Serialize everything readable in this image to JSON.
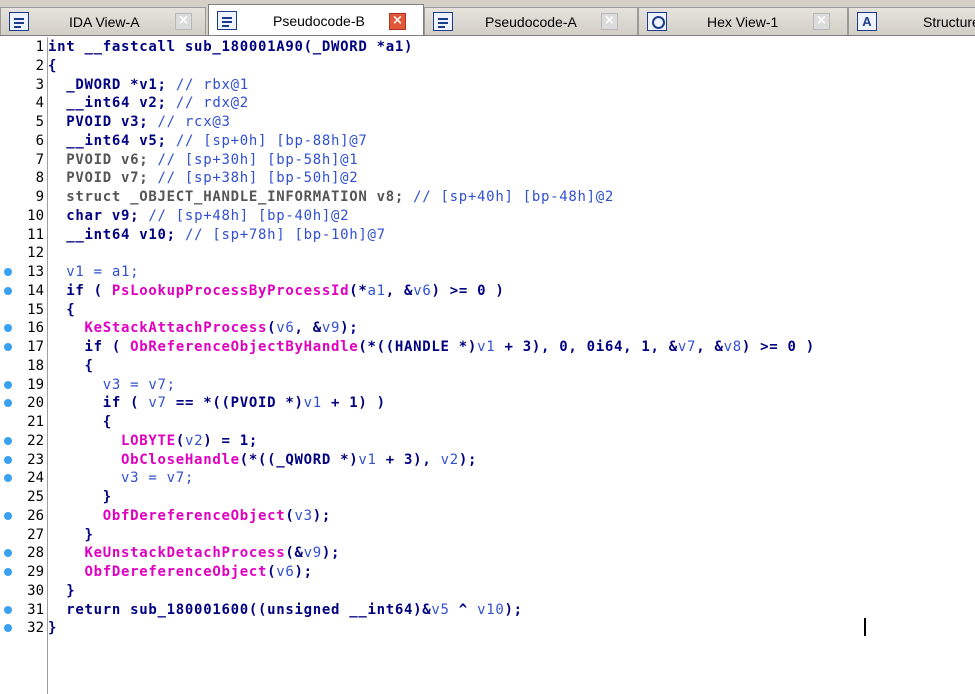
{
  "tabs": [
    {
      "label": "IDA View-A",
      "icon": "disassembly-icon",
      "close": "×",
      "active": false
    },
    {
      "label": "Pseudocode-B",
      "icon": "pseudocode-icon",
      "close": "×",
      "active": true
    },
    {
      "label": "Pseudocode-A",
      "icon": "pseudocode-icon",
      "close": "×",
      "active": false
    },
    {
      "label": "Hex View-1",
      "icon": "hex-view-icon",
      "close": "×",
      "active": false
    },
    {
      "label": "Structure",
      "icon": "structure-icon",
      "close": "",
      "active": false
    }
  ],
  "structure_icon_letter": "A",
  "code_lines": [
    {
      "n": "1",
      "bp": false,
      "tokens": [
        [
          "kw",
          "int __fastcall sub_180001A90(_DWORD *a1)"
        ]
      ]
    },
    {
      "n": "2",
      "bp": false,
      "tokens": [
        [
          "plain",
          "{"
        ]
      ]
    },
    {
      "n": "3",
      "bp": false,
      "tokens": [
        [
          "plain",
          "  _DWORD *v1; "
        ],
        [
          "cmt",
          "// rbx@1"
        ]
      ]
    },
    {
      "n": "4",
      "bp": false,
      "tokens": [
        [
          "plain",
          "  __int64 v2; "
        ],
        [
          "cmt",
          "// rdx@2"
        ]
      ]
    },
    {
      "n": "5",
      "bp": false,
      "tokens": [
        [
          "plain",
          "  PVOID v3; "
        ],
        [
          "cmt",
          "// rcx@3"
        ]
      ]
    },
    {
      "n": "6",
      "bp": false,
      "tokens": [
        [
          "plain",
          "  __int64 v5; "
        ],
        [
          "cmt",
          "// [sp+0h] [bp-88h]@7"
        ]
      ]
    },
    {
      "n": "7",
      "bp": false,
      "tokens": [
        [
          "dimb",
          "  PVOID v6; "
        ],
        [
          "cmt",
          "// [sp+30h] [bp-58h]@1"
        ]
      ]
    },
    {
      "n": "8",
      "bp": false,
      "tokens": [
        [
          "dimb",
          "  PVOID v7; "
        ],
        [
          "cmt",
          "// [sp+38h] [bp-50h]@2"
        ]
      ]
    },
    {
      "n": "9",
      "bp": false,
      "tokens": [
        [
          "dimb",
          "  struct _OBJECT_HANDLE_INFORMATION v8; "
        ],
        [
          "cmt",
          "// [sp+40h] [bp-48h]@2"
        ]
      ]
    },
    {
      "n": "10",
      "bp": false,
      "tokens": [
        [
          "plain",
          "  char v9; "
        ],
        [
          "cmt",
          "// [sp+48h] [bp-40h]@2"
        ]
      ]
    },
    {
      "n": "11",
      "bp": false,
      "tokens": [
        [
          "plain",
          "  __int64 v10; "
        ],
        [
          "cmt",
          "// [sp+78h] [bp-10h]@7"
        ]
      ]
    },
    {
      "n": "12",
      "bp": false,
      "tokens": []
    },
    {
      "n": "13",
      "bp": true,
      "tokens": [
        [
          "var",
          "  v1 = a1;"
        ]
      ]
    },
    {
      "n": "14",
      "bp": true,
      "tokens": [
        [
          "plain",
          "  if ( "
        ],
        [
          "fn",
          "PsLookupProcessByProcessId"
        ],
        [
          "plain",
          "(*"
        ],
        [
          "var",
          "a1"
        ],
        [
          "plain",
          ", &"
        ],
        [
          "var",
          "v6"
        ],
        [
          "plain",
          ") >= 0 )"
        ]
      ]
    },
    {
      "n": "15",
      "bp": false,
      "tokens": [
        [
          "plain",
          "  {"
        ]
      ]
    },
    {
      "n": "16",
      "bp": true,
      "tokens": [
        [
          "plain",
          "    "
        ],
        [
          "fn",
          "KeStackAttachProcess"
        ],
        [
          "plain",
          "("
        ],
        [
          "var",
          "v6"
        ],
        [
          "plain",
          ", &"
        ],
        [
          "var",
          "v9"
        ],
        [
          "plain",
          ");"
        ]
      ]
    },
    {
      "n": "17",
      "bp": true,
      "tokens": [
        [
          "plain",
          "    if ( "
        ],
        [
          "fn",
          "ObReferenceObjectByHandle"
        ],
        [
          "plain",
          "(*((HANDLE *)"
        ],
        [
          "var",
          "v1"
        ],
        [
          "plain",
          " + 3), 0, 0i64, 1, &"
        ],
        [
          "var",
          "v7"
        ],
        [
          "plain",
          ", &"
        ],
        [
          "var",
          "v8"
        ],
        [
          "plain",
          ") >= 0 )"
        ]
      ]
    },
    {
      "n": "18",
      "bp": false,
      "tokens": [
        [
          "plain",
          "    {"
        ]
      ]
    },
    {
      "n": "19",
      "bp": true,
      "tokens": [
        [
          "var",
          "      v3 = v7;"
        ]
      ]
    },
    {
      "n": "20",
      "bp": true,
      "tokens": [
        [
          "plain",
          "      if ( "
        ],
        [
          "var",
          "v7"
        ],
        [
          "plain",
          " == *((PVOID *)"
        ],
        [
          "var",
          "v1"
        ],
        [
          "plain",
          " + 1) )"
        ]
      ]
    },
    {
      "n": "21",
      "bp": false,
      "tokens": [
        [
          "plain",
          "      {"
        ]
      ]
    },
    {
      "n": "22",
      "bp": true,
      "tokens": [
        [
          "plain",
          "        "
        ],
        [
          "fn",
          "LOBYTE"
        ],
        [
          "plain",
          "("
        ],
        [
          "var",
          "v2"
        ],
        [
          "plain",
          ") = 1;"
        ]
      ]
    },
    {
      "n": "23",
      "bp": true,
      "tokens": [
        [
          "plain",
          "        "
        ],
        [
          "fn",
          "ObCloseHandle"
        ],
        [
          "plain",
          "(*((_QWORD *)"
        ],
        [
          "var",
          "v1"
        ],
        [
          "plain",
          " + 3), "
        ],
        [
          "var",
          "v2"
        ],
        [
          "plain",
          ");"
        ]
      ]
    },
    {
      "n": "24",
      "bp": true,
      "tokens": [
        [
          "var",
          "        v3 = v7;"
        ]
      ]
    },
    {
      "n": "25",
      "bp": false,
      "tokens": [
        [
          "plain",
          "      }"
        ]
      ]
    },
    {
      "n": "26",
      "bp": true,
      "tokens": [
        [
          "plain",
          "      "
        ],
        [
          "fn",
          "ObfDereferenceObject"
        ],
        [
          "plain",
          "("
        ],
        [
          "var",
          "v3"
        ],
        [
          "plain",
          ");"
        ]
      ]
    },
    {
      "n": "27",
      "bp": false,
      "tokens": [
        [
          "plain",
          "    }"
        ]
      ]
    },
    {
      "n": "28",
      "bp": true,
      "tokens": [
        [
          "plain",
          "    "
        ],
        [
          "fn",
          "KeUnstackDetachProcess"
        ],
        [
          "plain",
          "(&"
        ],
        [
          "var",
          "v9"
        ],
        [
          "plain",
          ");"
        ]
      ]
    },
    {
      "n": "29",
      "bp": true,
      "tokens": [
        [
          "plain",
          "    "
        ],
        [
          "fn",
          "ObfDereferenceObject"
        ],
        [
          "plain",
          "("
        ],
        [
          "var",
          "v6"
        ],
        [
          "plain",
          ");"
        ]
      ]
    },
    {
      "n": "30",
      "bp": false,
      "tokens": [
        [
          "plain",
          "  }"
        ]
      ]
    },
    {
      "n": "31",
      "bp": true,
      "tokens": [
        [
          "plain",
          "  return sub_180001600((unsigned __int64)&"
        ],
        [
          "var",
          "v5"
        ],
        [
          "plain",
          " ^ "
        ],
        [
          "var",
          "v10"
        ],
        [
          "plain",
          ");"
        ]
      ]
    },
    {
      "n": "32",
      "bp": true,
      "tokens": [
        [
          "plain",
          "}"
        ]
      ]
    }
  ],
  "colors": {
    "keyword": "#000080",
    "function": "#e000c0",
    "variable": "#3050d0",
    "breakpoint": "#3aa0f0",
    "close_active": "#e05a3a"
  }
}
